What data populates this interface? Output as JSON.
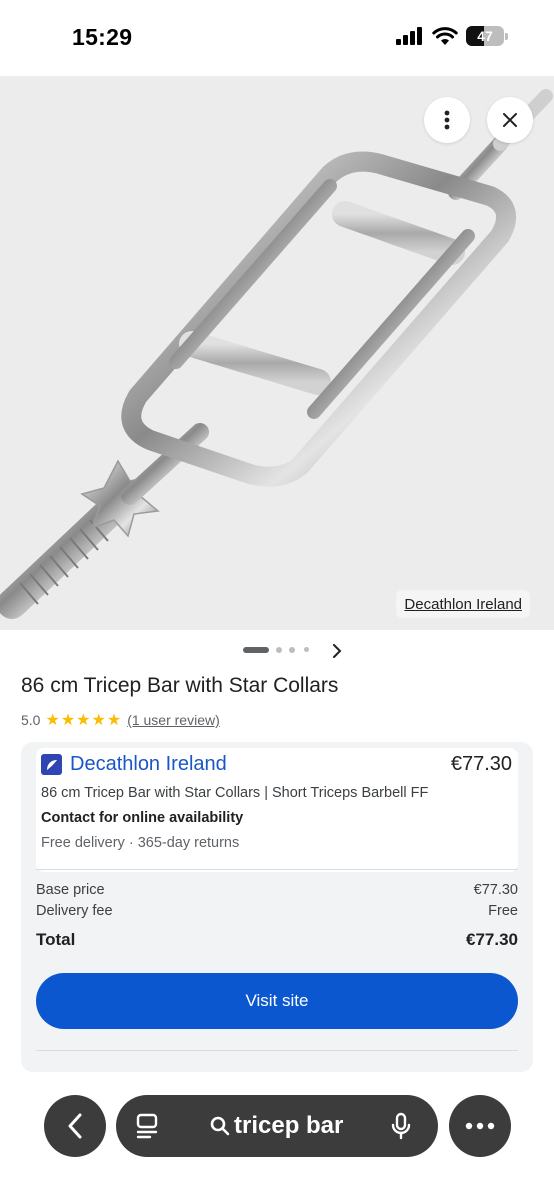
{
  "status_bar": {
    "time": "15:29",
    "battery": "47"
  },
  "hero": {
    "source_label": "Decathlon Ireland",
    "icons": {
      "more": "more-vert-icon",
      "close": "close-icon",
      "next": "chevron-right-icon"
    }
  },
  "product": {
    "title": "86 cm Tricep Bar with Star Collars",
    "rating_value": "5.0",
    "stars": "★★★★★",
    "review_link": "(1 user review)"
  },
  "offer": {
    "store_name": "Decathlon Ireland",
    "price": "€77.30",
    "description": "86 cm Tricep Bar with Star Collars | Short Triceps Barbell FF",
    "availability": "Contact for online availability",
    "delivery": "Free delivery · 365-day returns"
  },
  "price_breakdown": {
    "base_label": "Base price",
    "base_value": "€77.30",
    "delivery_label": "Delivery fee",
    "delivery_value": "Free",
    "total_label": "Total",
    "total_value": "€77.30"
  },
  "cta": {
    "visit_label": "Visit site"
  },
  "bottom_bar": {
    "search_query": "tricep bar",
    "icons": {
      "back": "back-arrow-icon",
      "tabs": "tabs-icon",
      "search": "search-icon",
      "mic": "mic-icon",
      "menu": "more-horiz-icon"
    }
  },
  "colors": {
    "accent": "#0b57d0",
    "store_link": "#1a56c9",
    "stars": "#fbbc04"
  }
}
